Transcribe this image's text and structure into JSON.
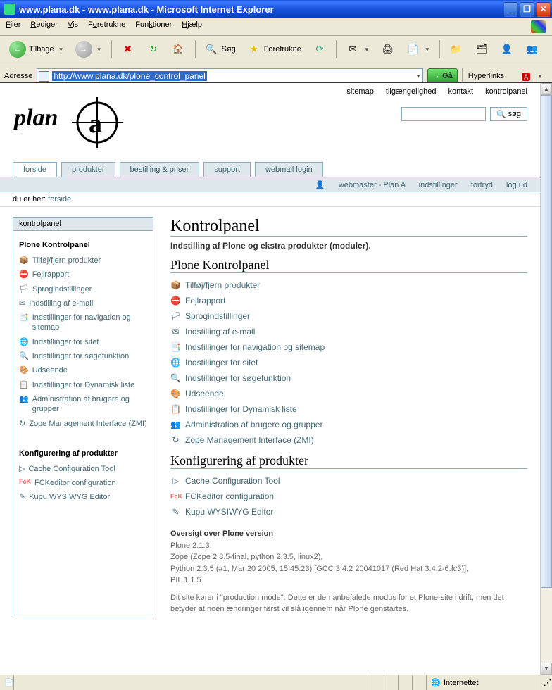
{
  "window": {
    "title": "www.plana.dk - www.plana.dk - Microsoft Internet Explorer"
  },
  "menubar": {
    "file": "Filer",
    "edit": "Rediger",
    "view": "Vis",
    "favorites": "Foretrukne",
    "tools": "Funktioner",
    "help": "Hjælp"
  },
  "toolbar": {
    "back": "Tilbage",
    "search": "Søg",
    "favorites": "Foretrukne"
  },
  "addressbar": {
    "label": "Adresse",
    "url": "http://www.plana.dk/plone_control_panel",
    "go": "Gå",
    "hyperlinks": "Hyperlinks"
  },
  "statusbar": {
    "zone": "Internettet"
  },
  "page": {
    "topmeta": {
      "sitemap": "sitemap",
      "accessibility": "tilgængelighed",
      "contact": "kontakt",
      "controlpanel": "kontrolpanel"
    },
    "search_button": "søg",
    "tabs": {
      "home": "forside",
      "products": "produkter",
      "ordering": "bestilling & priser",
      "support": "support",
      "webmail": "webmail login"
    },
    "userbar": {
      "user": "webmaster - Plan A",
      "settings": "indstillinger",
      "undo": "fortryd",
      "logout": "log ud"
    },
    "breadcrumb": {
      "label": "du er her:",
      "home": "forside"
    },
    "portlet": {
      "header": "kontrolpanel",
      "section_plone": "Plone Kontrolpanel",
      "items_plone": [
        "Tilføj/fjern produkter",
        "Fejlrapport",
        "Sprogindstillinger",
        "Indstilling af e-mail",
        "Indstillinger for navigation og sitemap",
        "Indstillinger for sitet",
        "Indstillinger for søgefunktion",
        "Udseende",
        "Indstillinger for Dynamisk liste",
        "Administration af brugere og grupper",
        "Zope Management Interface (ZMI)"
      ],
      "section_products": "Konfigurering af produkter",
      "items_products": [
        "Cache Configuration Tool",
        "FCKeditor configuration",
        "Kupu WYSIWYG Editor"
      ]
    },
    "main": {
      "h1": "Kontrolpanel",
      "desc": "Indstilling af Plone og ekstra produkter (moduler).",
      "h2_plone": "Plone Kontrolpanel",
      "links_plone": [
        "Tilføj/fjern produkter",
        "Fejlrapport",
        "Sprogindstillinger",
        "Indstilling af e-mail",
        "Indstillinger for navigation og sitemap",
        "Indstillinger for sitet",
        "Indstillinger for søgefunktion",
        "Udseende",
        "Indstillinger for Dynamisk liste",
        "Administration af brugere og grupper",
        "Zope Management Interface (ZMI)"
      ],
      "h2_products": "Konfigurering af produkter",
      "links_products": [
        "Cache Configuration Tool",
        "FCKeditor configuration",
        "Kupu WYSIWYG Editor"
      ],
      "version_heading": "Oversigt over Plone version",
      "version_lines": [
        "Plone 2.1.3,",
        "Zope (Zope 2.8.5-final, python 2.3.5, linux2),",
        "Python 2.3.5 (#1, Mar 20 2005, 15:45:23) [GCC 3.4.2 20041017 (Red Hat 3.4.2-6.fc3)],",
        "PIL 1.1.5"
      ],
      "mode_note": "Dit site kører i \"production mode\". Dette er den anbefalede modus for et Plone-site i drift, men det betyder at noen ændringer først vil slå igennem når Plone genstartes."
    }
  },
  "icons": {
    "plone_set": [
      "📦",
      "⛔",
      "🏳",
      "✉",
      "📑",
      "🌐",
      "🔍",
      "🎨",
      "📋",
      "👥",
      "↻"
    ],
    "product_set": [
      "▷",
      "FcK",
      "✎"
    ]
  }
}
